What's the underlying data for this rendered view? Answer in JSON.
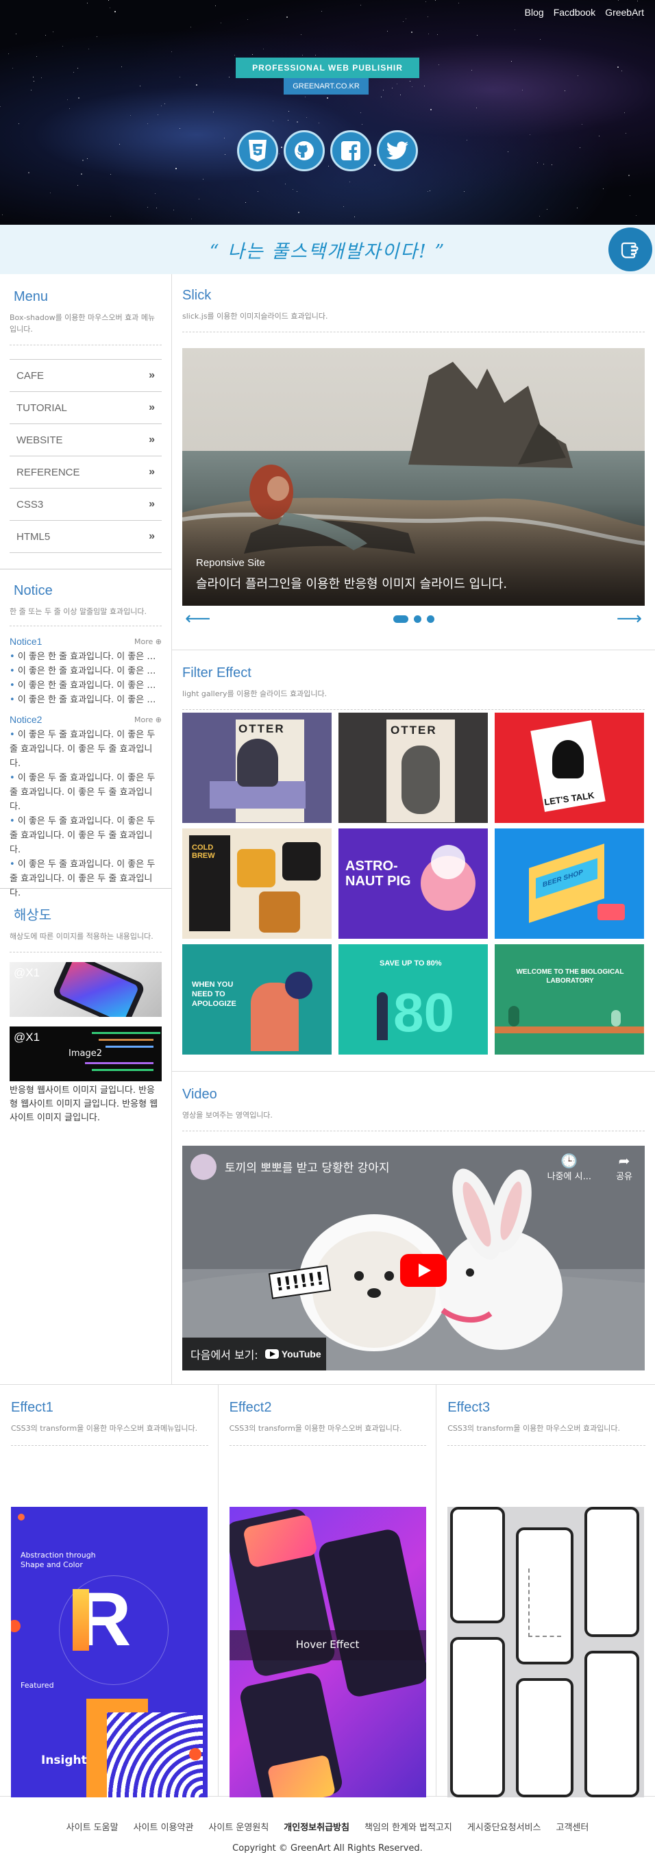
{
  "header": {
    "nav": [
      "Blog",
      "Facdbook",
      "GreebArt"
    ],
    "title": "PROFESSIONAL WEB PUBLISHIR",
    "url": "GREENART.CO.KR",
    "social_icons": [
      "html5-icon",
      "github-icon",
      "facebook-icon",
      "twitter-icon"
    ]
  },
  "slogan": {
    "text": "“ 나는 풀스택개발자이다! ”",
    "icon": "pointing-hand-icon"
  },
  "menu": {
    "title": "Menu",
    "desc": "Box-shadow를 이용한 마우스오버 효과 메뉴입니다.",
    "items": [
      "CAFE",
      "TUTORIAL",
      "WEBSITE",
      "REFERENCE",
      "CSS3",
      "HTML5"
    ]
  },
  "notice": {
    "title": "Notice",
    "desc": "한 줄 또는 두 줄 이상 말줄임말 효과입니다.",
    "more": "More",
    "notice1": {
      "name": "Notice1",
      "items": [
        "이 좋은 한 줄 효과입니다. 이 좋은 한 줄 효과입니다.",
        "이 좋은 한 줄 효과입니다. 이 좋은 한 줄 효과입니다.",
        "이 좋은 한 줄 효과입니다. 이 좋은 한 줄 효과입니다.",
        "이 좋은 한 줄 효과입니다. 이 좋은 한 줄 효과입니다."
      ]
    },
    "notice2": {
      "name": "Notice2",
      "items": [
        "이 좋은 두 줄 효과입니다. 이 좋은 두 줄 효과입니다. 이 좋은 두 줄 효과입니다.",
        "이 좋은 두 줄 효과입니다. 이 좋은 두 줄 효과입니다. 이 좋은 두 줄 효과입니다.",
        "이 좋은 두 줄 효과입니다. 이 좋은 두 줄 효과입니다. 이 좋은 두 줄 효과입니다.",
        "이 좋은 두 줄 효과입니다. 이 좋은 두 줄 효과입니다. 이 좋은 두 줄 효과입니다."
      ]
    }
  },
  "resolution": {
    "title": "해상도",
    "desc": "해상도에 따른 이미지를 적용하는 내용입니다.",
    "img1_label": "@X1",
    "img2_label": "@X1",
    "img2_text": "Image2",
    "caption": "반응형 웹사이트 이미지 글입니다. 반응형 웹사이트 이미지 글입니다. 반응형 웹사이트 이미지 글입니다."
  },
  "slick": {
    "title": "Slick",
    "desc": "slick.js를 이용한 이미지슬라이드 효과입니다.",
    "slide_sub": "Reponsive Site",
    "slide_text": "슬라이더 플러그인을 이용한 반응형 이미지 슬라이드 입니다."
  },
  "filter": {
    "title": "Filter Effect",
    "desc": "light gallery를 이용한 슬라이드 효과입니다.",
    "tiles": [
      "OTTER",
      "OTTER",
      "LET'S TALK",
      "COLD BREW",
      "ASTRO-NAUT PIG",
      "BEER SHOP",
      "WHEN YOU NEED TO APOLOGIZE",
      "SAVE UP TO 80%",
      "WELCOME TO THE BIOLOGICAL LABORATORY"
    ]
  },
  "video": {
    "title": "Video",
    "desc": "영상을 보여주는 영역입니다.",
    "video_title": "토끼의 뽀뽀를 받고 당황한 강아지",
    "watch_later": "나중에 시...",
    "share": "공유",
    "watch_on": "다음에서 보기:",
    "yt": "YouTube",
    "overlay": "!!!!!!"
  },
  "effects": [
    {
      "title": "Effect1",
      "desc": "CSS3의 transform을 이용한 마우스오버 효과메뉴입니다.",
      "img_heading": "Abstraction through Shape and Color",
      "img_sub": "Featured",
      "img_insight": "Insight"
    },
    {
      "title": "Effect2",
      "desc": "CSS3의 transform을 이용한 마우스오버 효과입니다.",
      "hover": "Hover Effect"
    },
    {
      "title": "Effect3",
      "desc": "CSS3의 transform을 이용한 마우스오버 효과입니다."
    }
  ],
  "footer": {
    "links": [
      "사이트 도움말",
      "사이트 이용약관",
      "사이트 운영원칙",
      "개인정보취급방침",
      "책임의 한계와 법적고지",
      "게시중단요청서비스",
      "고객센터"
    ],
    "copyright": "Copyright © GreenArt All Rights Reserved."
  }
}
